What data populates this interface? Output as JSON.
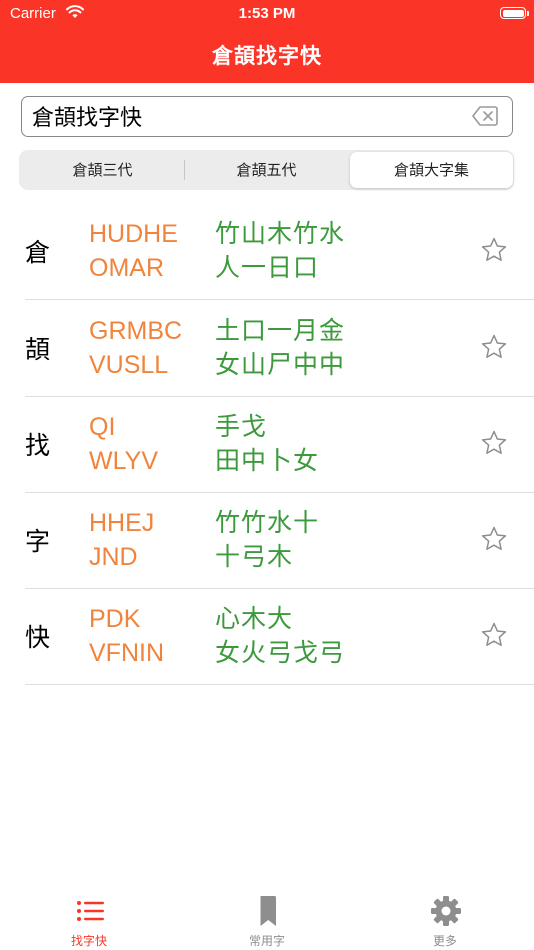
{
  "status_bar": {
    "carrier": "Carrier",
    "time": "1:53 PM"
  },
  "nav": {
    "title": "倉頡找字快"
  },
  "search": {
    "value": "倉頡找字快",
    "placeholder": ""
  },
  "segments": [
    "倉頡三代",
    "倉頡五代",
    "倉頡大字集"
  ],
  "selected_segment": "倉頡大字集",
  "results": [
    {
      "char": "倉",
      "code1": "HUDHE",
      "code2": "OMAR",
      "rad1": "竹山木竹水",
      "rad2": "人一日口"
    },
    {
      "char": "頡",
      "code1": "GRMBC",
      "code2": "VUSLL",
      "rad1": "土口一月金",
      "rad2": "女山尸中中"
    },
    {
      "char": "找",
      "code1": "QI",
      "code2": "WLYV",
      "rad1": "手戈",
      "rad2": "田中卜女"
    },
    {
      "char": "字",
      "code1": "HHEJ",
      "code2": "JND",
      "rad1": "竹竹水十",
      "rad2": "十弓木"
    },
    {
      "char": "快",
      "code1": "PDK",
      "code2": "VFNIN",
      "rad1": "心木大",
      "rad2": "女火弓戈弓"
    }
  ],
  "tabs": [
    {
      "label": "找字快",
      "icon": "list-icon",
      "active": true
    },
    {
      "label": "常用字",
      "icon": "bookmark-icon",
      "active": false
    },
    {
      "label": "更多",
      "icon": "gear-icon",
      "active": false
    }
  ],
  "colors": {
    "accent": "#fa3528",
    "code": "#f0843c",
    "radical": "#3c9a3c",
    "inactive": "#8e8e8e"
  }
}
